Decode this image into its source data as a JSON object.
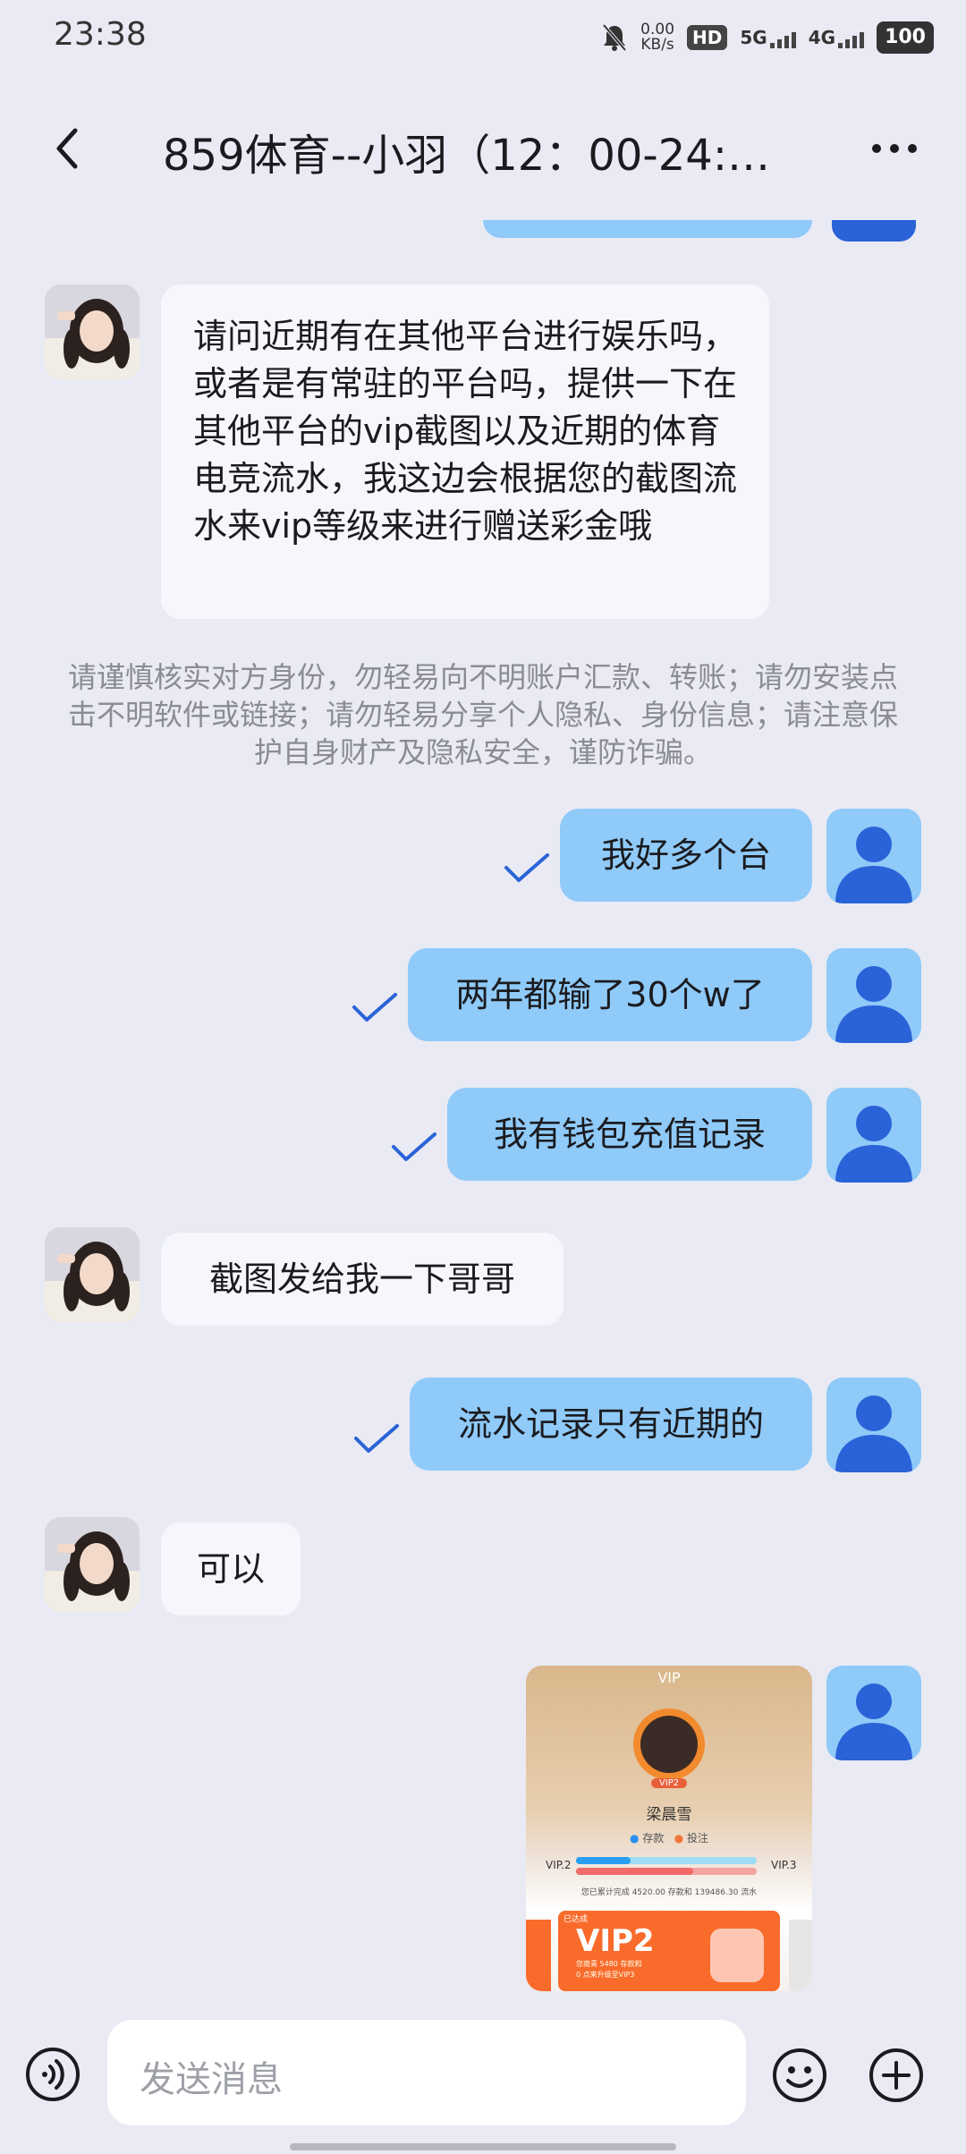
{
  "status_bar": {
    "time": "23:38",
    "net_speed_value": "0.00",
    "net_speed_unit": "KB/s",
    "hd_label": "HD",
    "net1": "5G",
    "net2": "4G",
    "battery": "100"
  },
  "header": {
    "title": "859体育--小羽（12：00-24:…",
    "back_icon": "back-arrow-icon",
    "more_icon": "more-dots-icon"
  },
  "messages": {
    "m1": "请问近期有在其他平台进行娱乐吗，或者是有常驻的平台吗，提供一下在其他平台的vip截图以及近期的体育电竞流水，我这边会根据您的截图流水来vip等级来进行赠送彩金哦",
    "notice": "请谨慎核实对方身份，勿轻易向不明账户汇款、转账；请勿安装点击不明软件或链接；请勿轻易分享个人隐私、身份信息；请注意保护自身财产及隐私安全，谨防诈骗。",
    "m2": "我好多个台",
    "m3": "两年都输了30个w了",
    "m4": "我有钱包充值记录",
    "m5": "截图发给我一下哥哥",
    "m6": "流水记录只有近期的",
    "m7": "可以"
  },
  "screenshot": {
    "title": "VIP",
    "badge": "VIP2",
    "name": "梁晨雪",
    "option1": "存款",
    "option2": "投注",
    "level_from": "VIP.2",
    "level_to": "VIP.3",
    "progress_deposit": 0.3,
    "progress_bet": 0.65,
    "stats": "您已累计完成 4520.00 存款和 139486.30 流水",
    "card_tag": "已达成",
    "card_level": "VIP2",
    "card_line1": "您南青 5480 存款和",
    "card_line2": "0 点来升级至VIP3"
  },
  "input": {
    "placeholder": "发送消息",
    "voice_icon": "voice-icon",
    "emoji_icon": "emoji-icon",
    "plus_icon": "plus-icon"
  },
  "colors": {
    "background": "#e9eaf3",
    "incoming_bubble": "#f6f7fc",
    "outgoing_bubble": "#8fcaf9",
    "check": "#2a63d8",
    "user_avatar": "#2a63d8"
  }
}
